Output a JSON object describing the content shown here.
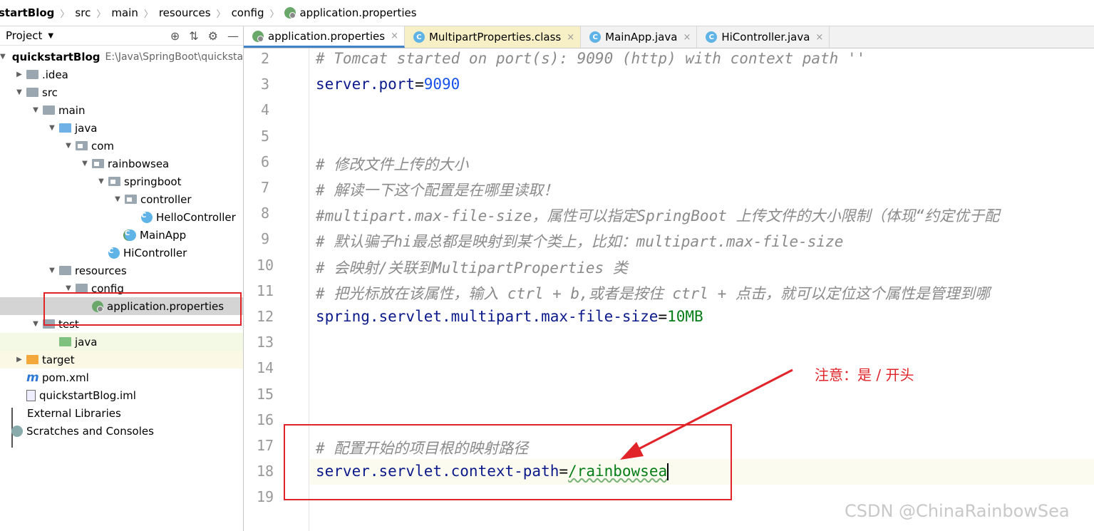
{
  "breadcrumb": [
    "startBlog",
    "src",
    "main",
    "resources",
    "config",
    "application.properties"
  ],
  "project_panel": {
    "title": "Project"
  },
  "tree": [
    {
      "label": "quickstartBlog",
      "extra": "E:\\Java\\SpringBoot\\quickstar",
      "depth": 0,
      "arrow": "▼",
      "icon": "folder-icon"
    },
    {
      "label": ".idea",
      "depth": 1,
      "arrow": "▶",
      "icon": "folder-icon"
    },
    {
      "label": "src",
      "depth": 1,
      "arrow": "▼",
      "icon": "folder-icon"
    },
    {
      "label": "main",
      "depth": 2,
      "arrow": "▼",
      "icon": "folder-icon"
    },
    {
      "label": "java",
      "depth": 3,
      "arrow": "▼",
      "icon": "source-folder-icon"
    },
    {
      "label": "com",
      "depth": 4,
      "arrow": "▼",
      "icon": "package-icon"
    },
    {
      "label": "rainbowsea",
      "depth": 5,
      "arrow": "▼",
      "icon": "package-icon"
    },
    {
      "label": "springboot",
      "depth": 6,
      "arrow": "▼",
      "icon": "package-icon"
    },
    {
      "label": "controller",
      "depth": 7,
      "arrow": "▼",
      "icon": "package-icon"
    },
    {
      "label": "HelloController",
      "depth": 8,
      "arrow": "",
      "icon": "class-icon"
    },
    {
      "label": "MainApp",
      "depth": 7,
      "arrow": "",
      "icon": "spring-class-icon"
    },
    {
      "label": "HiController",
      "depth": 6,
      "arrow": "",
      "icon": "class-icon"
    },
    {
      "label": "resources",
      "depth": 3,
      "arrow": "▼",
      "icon": "resources-folder-icon"
    },
    {
      "label": "config",
      "depth": 4,
      "arrow": "▼",
      "icon": "folder-icon"
    },
    {
      "label": "application.properties",
      "depth": 5,
      "arrow": "",
      "icon": "spring-properties-icon"
    },
    {
      "label": "test",
      "depth": 2,
      "arrow": "▼",
      "icon": "folder-icon"
    },
    {
      "label": "java",
      "depth": 3,
      "arrow": "",
      "icon": "test-folder-icon"
    },
    {
      "label": "target",
      "depth": 1,
      "arrow": "▶",
      "icon": "excluded-folder-icon"
    },
    {
      "label": "pom.xml",
      "depth": 1,
      "arrow": "",
      "icon": "maven-icon"
    },
    {
      "label": "quickstartBlog.iml",
      "depth": 1,
      "arrow": "",
      "icon": "iml-icon"
    },
    {
      "label": "External Libraries",
      "depth": 0,
      "arrow": "",
      "icon": "libraries-icon"
    },
    {
      "label": "Scratches and Consoles",
      "depth": 0,
      "arrow": "",
      "icon": "scratches-icon"
    }
  ],
  "tabs": [
    {
      "label": "application.properties",
      "active": true
    },
    {
      "label": "MultipartProperties.class",
      "active": false
    },
    {
      "label": "MainApp.java",
      "active": false
    },
    {
      "label": "HiController.java",
      "active": false
    }
  ],
  "editor": {
    "line_numbers": [
      "2",
      "3",
      "4",
      "5",
      "6",
      "7",
      "8",
      "9",
      "10",
      "11",
      "12",
      "13",
      "14",
      "15",
      "16",
      "17",
      "18",
      "19"
    ],
    "lines": [
      {
        "type": "comment",
        "text": "# Tomcat started on port(s): 9090 (http) with context path ''"
      },
      {
        "type": "kv",
        "key": "server.port",
        "value": "9090",
        "vclass": "num"
      },
      {
        "type": "blank",
        "text": ""
      },
      {
        "type": "blank",
        "text": ""
      },
      {
        "type": "comment",
        "text": "# 修改文件上传的大小"
      },
      {
        "type": "comment",
        "text": "# 解读一下这个配置是在哪里读取！"
      },
      {
        "type": "comment",
        "text": "#multipart.max-file-size，属性可以指定SpringBoot 上传文件的大小限制（体现“约定优于配"
      },
      {
        "type": "comment",
        "text": "# 默认骗子hi最总都是映射到某个类上，比如：multipart.max-file-size"
      },
      {
        "type": "comment",
        "text": "# 会映射/关联到MultipartProperties 类"
      },
      {
        "type": "comment",
        "text": "# 把光标放在该属性，输入 ctrl + b,或者是按住 ctrl + 点击，就可以定位这个属性是管理到哪"
      },
      {
        "type": "kv",
        "key": "spring.servlet.multipart.max-file-size",
        "value": "10MB",
        "vclass": "val"
      },
      {
        "type": "blank",
        "text": ""
      },
      {
        "type": "blank",
        "text": ""
      },
      {
        "type": "blank",
        "text": ""
      },
      {
        "type": "blank",
        "text": ""
      },
      {
        "type": "comment",
        "text": "# 配置开始的项目根的映射路径"
      },
      {
        "type": "kv",
        "key": "server.servlet.context-path",
        "value": "/rainbowsea",
        "vclass": "val"
      },
      {
        "type": "blank",
        "text": ""
      }
    ]
  },
  "annotation": {
    "note": "注意：是 / 开头",
    "color": "#e0242a"
  },
  "watermark": "CSDN @ChinaRainbowSea"
}
